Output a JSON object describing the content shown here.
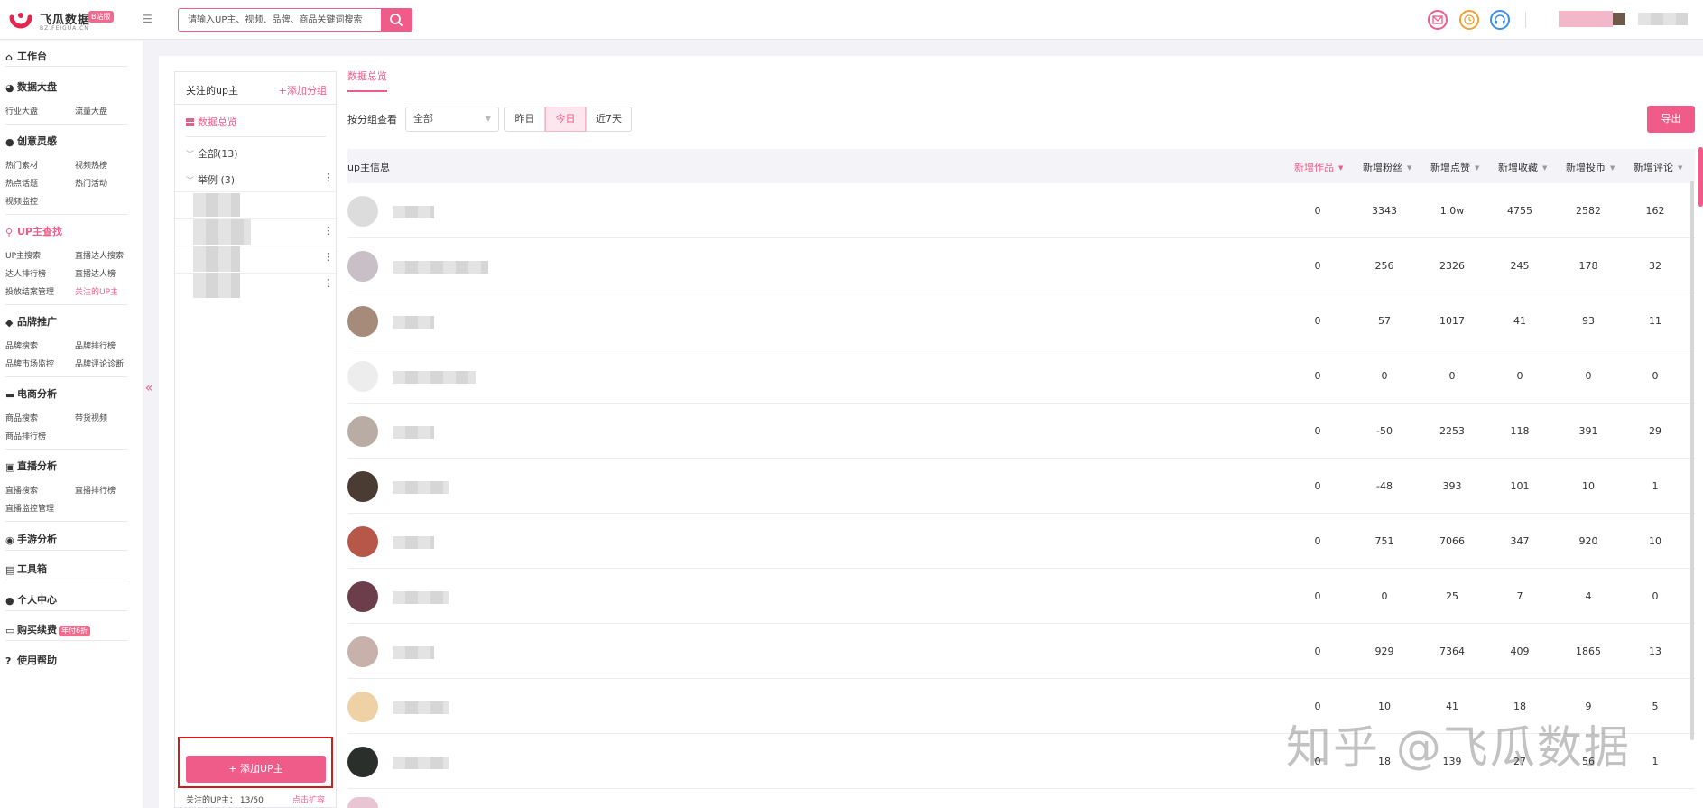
{
  "brand": {
    "name": "飞瓜数据",
    "badge": "B站版",
    "domain": "BZ.FEIGUA.CN",
    "accent": "#ef5c8a"
  },
  "header": {
    "search_placeholder": "请输入UP主、视频、品牌、商品关键词搜索",
    "icons": [
      "mail-icon",
      "clock-icon",
      "headset-icon"
    ]
  },
  "sidebar": {
    "workbench": "工作台",
    "data_board": {
      "title": "数据大盘",
      "items": [
        "行业大盘",
        "流量大盘"
      ]
    },
    "creative": {
      "title": "创意灵感",
      "items": [
        "热门素材",
        "视频热榜",
        "热点话题",
        "热门活动",
        "视频监控"
      ]
    },
    "up_search": {
      "title": "UP主查找",
      "items": [
        "UP主搜索",
        "直播达人搜索",
        "达人排行榜",
        "直播达人榜",
        "投放结案管理",
        "关注的UP主"
      ]
    },
    "brand": {
      "title": "品牌推广",
      "items": [
        "品牌搜索",
        "品牌排行榜",
        "品牌市场监控",
        "品牌评论诊断"
      ]
    },
    "ecommerce": {
      "title": "电商分析",
      "items": [
        "商品搜索",
        "带货视频",
        "商品排行榜"
      ]
    },
    "live": {
      "title": "直播分析",
      "items": [
        "直播搜索",
        "直播排行榜",
        "直播监控管理"
      ]
    },
    "mobile_game": "手游分析",
    "toolbox": "工具箱",
    "profile": "个人中心",
    "purchase": "购买续费",
    "purchase_badge": "年付6折",
    "help": "使用帮助"
  },
  "follow_panel": {
    "title": "关注的up主",
    "add_group": "+添加分组",
    "overview": "数据总览",
    "groups": [
      "全部(13)",
      "举例 (3)"
    ],
    "add_up_button": "+ 添加UP主",
    "quota": "关注的UP主： 13/50",
    "expand": "点击扩容"
  },
  "content": {
    "tab": "数据总览",
    "filter_label": "按分组查看",
    "group_select": "全部",
    "ranges": [
      "昨日",
      "今日",
      "近7天"
    ],
    "active_range": "今日",
    "export": "导出"
  },
  "table": {
    "columns": [
      "up主信息",
      "新增作品",
      "新增粉丝",
      "新增点赞",
      "新增收藏",
      "新增投币",
      "新增评论"
    ],
    "sorted_column": "新增作品",
    "rows": [
      [
        "0",
        "3343",
        "1.0w",
        "4755",
        "2582",
        "162"
      ],
      [
        "0",
        "256",
        "2326",
        "245",
        "178",
        "32"
      ],
      [
        "0",
        "57",
        "1017",
        "41",
        "93",
        "11"
      ],
      [
        "0",
        "0",
        "0",
        "0",
        "0",
        "0"
      ],
      [
        "0",
        "-50",
        "2253",
        "118",
        "391",
        "29"
      ],
      [
        "0",
        "-48",
        "393",
        "101",
        "10",
        "1"
      ],
      [
        "0",
        "751",
        "7066",
        "347",
        "920",
        "10"
      ],
      [
        "0",
        "0",
        "25",
        "7",
        "4",
        "0"
      ],
      [
        "0",
        "929",
        "7364",
        "409",
        "1865",
        "13"
      ],
      [
        "0",
        "10",
        "41",
        "18",
        "9",
        "5"
      ],
      [
        "0",
        "18",
        "139",
        "27",
        "56",
        "1"
      ]
    ]
  },
  "watermark": "知乎 @飞瓜数据"
}
